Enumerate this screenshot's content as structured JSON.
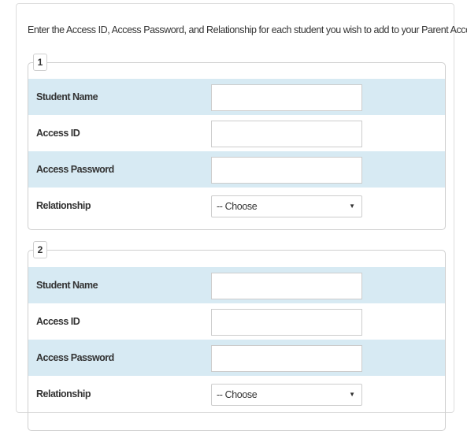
{
  "instructions": "Enter the Access ID, Access Password, and Relationship for each student you wish to add to your Parent Account",
  "students": [
    {
      "number": "1",
      "student_name_label": "Student Name",
      "student_name_value": "",
      "access_id_label": "Access ID",
      "access_id_value": "",
      "access_password_label": "Access Password",
      "access_password_value": "",
      "relationship_label": "Relationship",
      "relationship_selected": "-- Choose",
      "caret": "▼"
    },
    {
      "number": "2",
      "student_name_label": "Student Name",
      "student_name_value": "",
      "access_id_label": "Access ID",
      "access_id_value": "",
      "access_password_label": "Access Password",
      "access_password_value": "",
      "relationship_label": "Relationship",
      "relationship_selected": "-- Choose",
      "caret": "▼"
    }
  ],
  "colors": {
    "row_shade": "#d7eaf3",
    "border": "#cfcfcf",
    "text": "#333333"
  }
}
